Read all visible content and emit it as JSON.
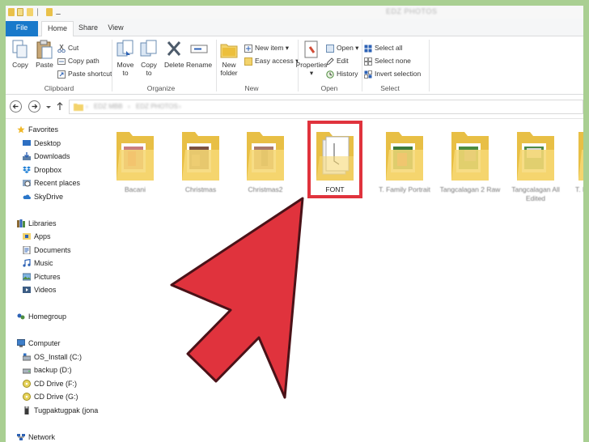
{
  "window": {
    "title": "EDZ PHOTOS"
  },
  "tabs": [
    {
      "label": "File",
      "active": false
    },
    {
      "label": "Home",
      "active": true
    },
    {
      "label": "Share",
      "active": false
    },
    {
      "label": "View",
      "active": false
    }
  ],
  "ribbon": {
    "clipboard": {
      "label": "Clipboard",
      "copy": "Copy",
      "paste": "Paste",
      "cut": "Cut",
      "copy_path": "Copy path",
      "paste_shortcut": "Paste shortcut"
    },
    "organize": {
      "label": "Organize",
      "move_to": "Move",
      "move_to_2": "to",
      "copy_to": "Copy",
      "copy_to_2": "to",
      "delete": "Delete",
      "rename": "Rename"
    },
    "new": {
      "label": "New",
      "new_folder": "New",
      "new_folder_2": "folder",
      "new_item": "New item",
      "easy_access": "Easy access"
    },
    "open": {
      "label": "Open",
      "properties": "Properties",
      "open": "Open",
      "edit": "Edit",
      "history": "History"
    },
    "select": {
      "label": "Select",
      "select_all": "Select all",
      "select_none": "Select none",
      "invert_selection": "Invert selection"
    }
  },
  "address": {
    "crumbs": [
      "EDZ MBB",
      "EDZ PHOTOS"
    ]
  },
  "nav": {
    "favorites": "Favorites",
    "favorites_items": [
      "Desktop",
      "Downloads",
      "Dropbox",
      "Recent places",
      "SkyDrive"
    ],
    "libraries": "Libraries",
    "libraries_items": [
      "Apps",
      "Documents",
      "Music",
      "Pictures",
      "Videos"
    ],
    "homegroup": "Homegroup",
    "computer": "Computer",
    "computer_items": [
      "OS_Install (C:)",
      "backup (D:)",
      "CD Drive (F:)",
      "CD Drive (G:)",
      "Tugpaktugpak (jona"
    ],
    "network": "Network"
  },
  "folders": [
    {
      "name": "Bacani",
      "selected": false
    },
    {
      "name": "Christmas",
      "selected": false
    },
    {
      "name": "Christmas2",
      "selected": false
    },
    {
      "name": "FONT",
      "selected": true
    },
    {
      "name": "T. Family Portrait",
      "selected": false
    },
    {
      "name": "Tangcalagan 2 Raw",
      "selected": false
    },
    {
      "name": "Tangcalagan All Edited",
      "selected": false
    },
    {
      "name": "T. Fa",
      "selected": false
    }
  ],
  "colors": {
    "accent": "#1979ca",
    "highlight": "#e0333d",
    "folder": "#f3d36c",
    "background": "#a9cf92"
  }
}
